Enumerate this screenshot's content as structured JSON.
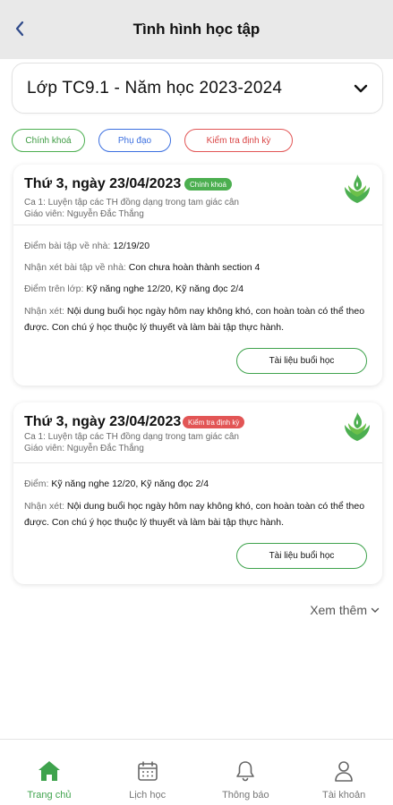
{
  "header": {
    "title": "Tình hình học tập",
    "back_icon": "chevron-left-icon"
  },
  "class_select": {
    "label": "Lớp TC9.1 - Năm học 2023-2024",
    "icon": "chevron-down-icon"
  },
  "filters": [
    {
      "label": "Chính khoá",
      "color": "#4caf50"
    },
    {
      "label": "Phụ đạo",
      "color": "#3b6fe0"
    },
    {
      "label": "Kiểm tra định kỳ",
      "color": "#e25555"
    }
  ],
  "cards": [
    {
      "date": "Thứ 3, ngày 23/04/2023",
      "badge": "Chính khoá",
      "badge_color": "#4caf50",
      "session": "Ca 1: Luyện tập các TH đồng dạng trong tam giác cân",
      "teacher": "Giáo viên: Nguyễn Đắc Thắng",
      "rows": [
        {
          "key": "Điểm bài tập về nhà:",
          "value": "12/19/20"
        },
        {
          "key": "Nhận xét bài tập về nhà:",
          "value": "Con chưa hoàn thành section 4"
        },
        {
          "key": "Điểm trên lớp:",
          "value": "Kỹ năng nghe 12/20, Kỹ năng đọc 2/4"
        },
        {
          "key": "Nhận xét:",
          "value": "Nội dung buổi học ngày hôm nay không khó, con hoàn toàn có thể theo được. Con chú ý học thuộc lý thuyết và làm bài tập thực hành."
        }
      ],
      "button": "Tài liệu buổi học"
    },
    {
      "date": "Thứ 3, ngày 23/04/2023",
      "badge": "Kiểm tra định kỳ",
      "badge_color": "#e25555",
      "session": "Ca 1: Luyện tập các TH đồng dạng trong tam giác cân",
      "teacher": "Giáo viên: Nguyễn Đắc Thắng",
      "rows": [
        {
          "key": "Điểm:",
          "value": "Kỹ năng nghe 12/20, Kỹ năng đọc 2/4"
        },
        {
          "key": "Nhận xét:",
          "value": "Nội dung buổi học ngày hôm nay không khó, con hoàn toàn có thể theo được. Con chú ý học thuộc lý thuyết và làm bài tập thực hành."
        }
      ],
      "button": "Tài liệu buổi học"
    }
  ],
  "more": {
    "label": "Xem thêm",
    "icon": "chevron-down-icon"
  },
  "tabs": [
    {
      "label": "Trang chủ",
      "icon": "home-icon",
      "active": true
    },
    {
      "label": "Lịch học",
      "icon": "calendar-icon",
      "active": false
    },
    {
      "label": "Thông báo",
      "icon": "bell-icon",
      "active": false
    },
    {
      "label": "Tài khoản",
      "icon": "user-icon",
      "active": false
    }
  ],
  "colors": {
    "accent": "#3fa34d",
    "header_bg": "#e9e9e9"
  }
}
